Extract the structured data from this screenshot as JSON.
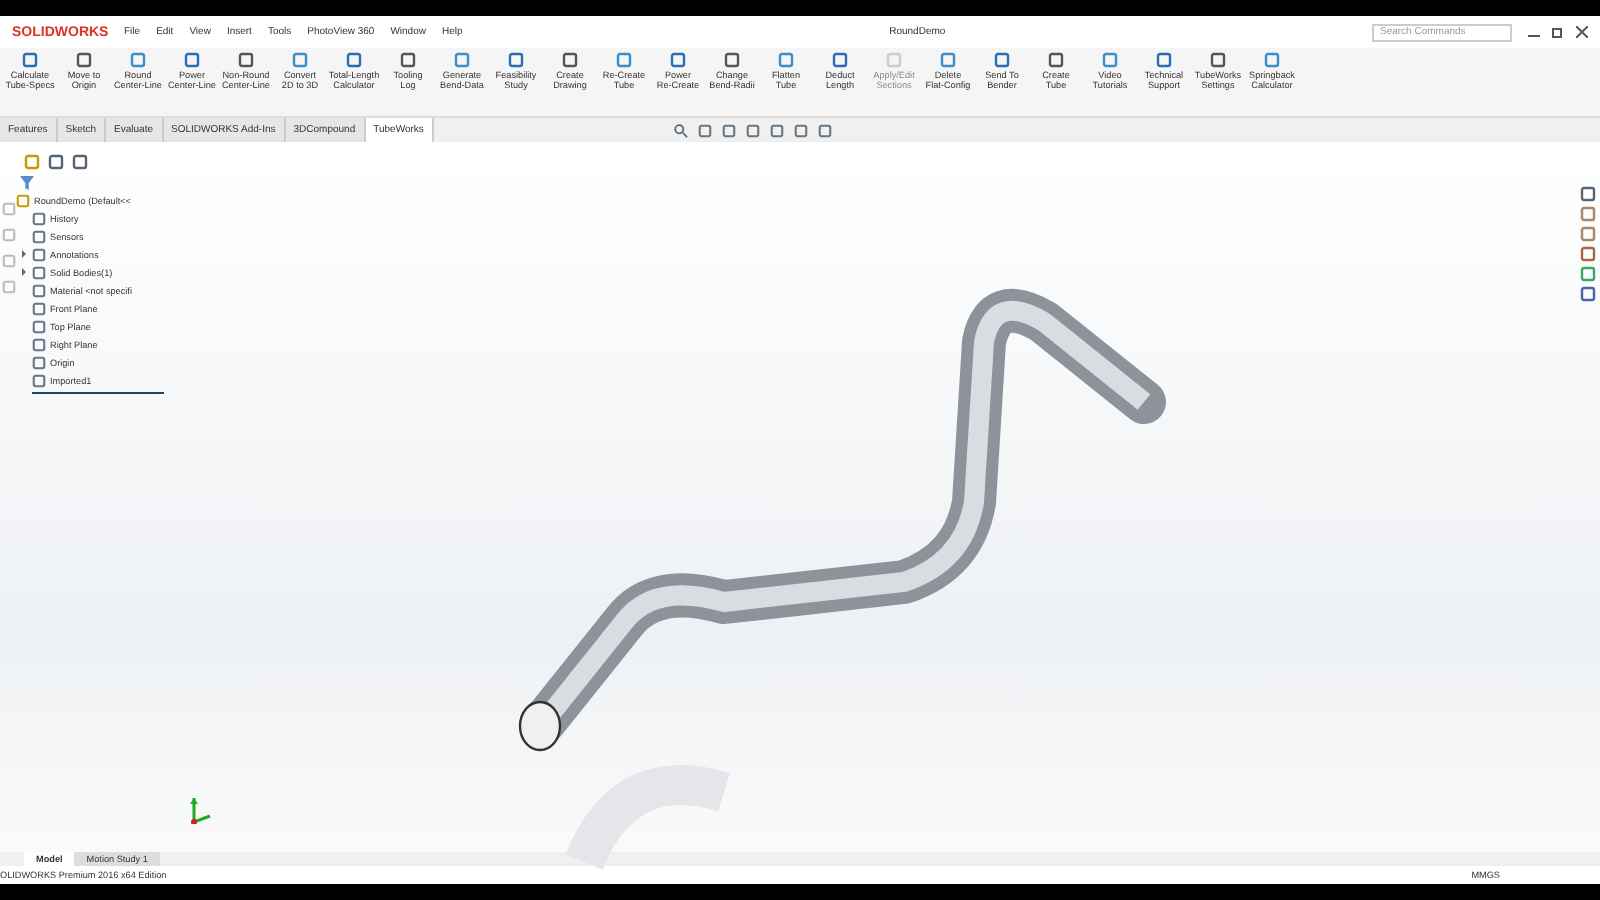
{
  "app": {
    "logo": "SOLIDWORKS",
    "title": "RoundDemo",
    "search": {
      "placeholder": "Search Commands"
    }
  },
  "menu": [
    "File",
    "Edit",
    "View",
    "Insert",
    "Tools",
    "PhotoView 360",
    "Window",
    "Help"
  ],
  "ribbon": [
    {
      "label": "Calculate\nTube-Specs",
      "disabled": false
    },
    {
      "label": "Move to\nOrigin",
      "disabled": false
    },
    {
      "label": "Round\nCenter-Line",
      "disabled": false
    },
    {
      "label": "Power\nCenter-Line",
      "disabled": false
    },
    {
      "label": "Non-Round\nCenter-Line",
      "disabled": false
    },
    {
      "label": "Convert\n2D to 3D",
      "disabled": false
    },
    {
      "label": "Total-Length\nCalculator",
      "disabled": false
    },
    {
      "label": "Tooling\nLog",
      "disabled": false
    },
    {
      "label": "Generate\nBend-Data",
      "disabled": false
    },
    {
      "label": "Feasibility\nStudy",
      "disabled": false
    },
    {
      "label": "Create\nDrawing",
      "disabled": false
    },
    {
      "label": "Re-Create\nTube",
      "disabled": false
    },
    {
      "label": "Power\nRe-Create",
      "disabled": false
    },
    {
      "label": "Change\nBend-Radii",
      "disabled": false
    },
    {
      "label": "Flatten\nTube",
      "disabled": false
    },
    {
      "label": "Deduct\nLength",
      "disabled": false
    },
    {
      "label": "Apply/Edit\nSections",
      "disabled": true
    },
    {
      "label": "Delete\nFlat-Config",
      "disabled": false
    },
    {
      "label": "Send To\nBender",
      "disabled": false
    },
    {
      "label": "Create\nTube",
      "disabled": false
    },
    {
      "label": "Video\nTutorials",
      "disabled": false
    },
    {
      "label": "Technical\nSupport",
      "disabled": false
    },
    {
      "label": "TubeWorks\nSettings",
      "disabled": false
    },
    {
      "label": "Springback\nCalculator",
      "disabled": false
    }
  ],
  "tabs": [
    {
      "label": "Features",
      "selected": false
    },
    {
      "label": "Sketch",
      "selected": false
    },
    {
      "label": "Evaluate",
      "selected": false
    },
    {
      "label": "SOLIDWORKS Add-Ins",
      "selected": false
    },
    {
      "label": "3DCompound",
      "selected": false
    },
    {
      "label": "TubeWorks",
      "selected": true
    }
  ],
  "tree": {
    "root": "RoundDemo  (Default<<",
    "items": [
      {
        "label": "History",
        "arrow": false
      },
      {
        "label": "Sensors",
        "arrow": false
      },
      {
        "label": "Annotations",
        "arrow": true
      },
      {
        "label": "Solid Bodies(1)",
        "arrow": true
      },
      {
        "label": "Material <not specifi",
        "arrow": false
      },
      {
        "label": "Front Plane",
        "arrow": false
      },
      {
        "label": "Top Plane",
        "arrow": false
      },
      {
        "label": "Right Plane",
        "arrow": false
      },
      {
        "label": "Origin",
        "arrow": false
      },
      {
        "label": "Imported1",
        "arrow": false
      }
    ]
  },
  "bottom_tabs": [
    {
      "label": "Model",
      "selected": true
    },
    {
      "label": "Motion Study 1",
      "selected": false
    }
  ],
  "status_bar": {
    "text": "OLIDWORKS Premium 2016 x64 Edition",
    "units": "MMGS"
  }
}
